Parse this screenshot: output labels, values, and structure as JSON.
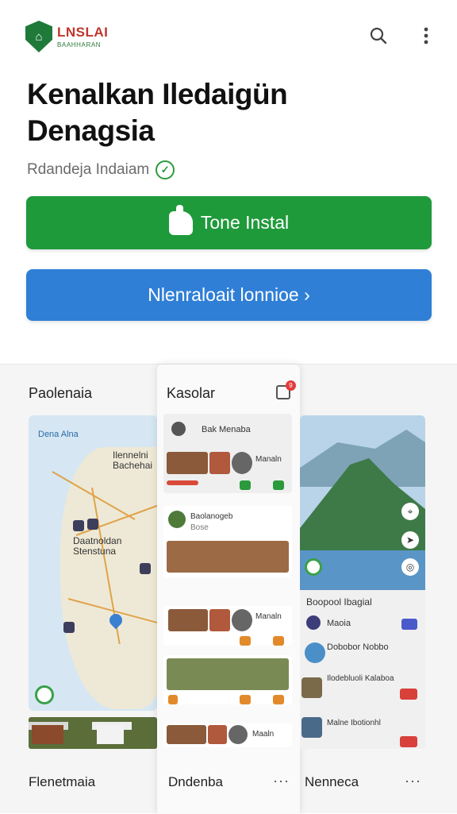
{
  "header": {
    "logo_icon": "shield-icon",
    "logo_text": "LNSLAI",
    "logo_subtext": "BAAHHARAN"
  },
  "hero": {
    "title_line1": "Kenalkan Iledaigün",
    "title_line2": "Denagsia",
    "subtitle": "Rdandeja  Indaiam"
  },
  "buttons": {
    "install_label": "Tone Instal",
    "more_label": "Nlenraloait lonnioe ›"
  },
  "colors": {
    "install_green": "#1f9a3b",
    "more_blue": "#2f7fd6"
  },
  "gallery": {
    "left": {
      "title": "Paolenaia",
      "map_label_top": "Dena   Alna",
      "map_label_mid": "Ilennelni\nBachehai",
      "map_label_city": "Daatnoldan\nStenstuna",
      "bottom_title": "Flenetmaia"
    },
    "center": {
      "title": "Kasolar",
      "badge_count": "9",
      "card_title": "Bak Menaba",
      "row1_title": "Manaln",
      "row2_title": "Baolanogeb",
      "row2_sub": "Bose",
      "row3_title": "Manaln",
      "row4_title": "Maaln",
      "bottom_title": "Dndenba"
    },
    "right": {
      "section_title": "Boopool  Ibagial",
      "row1_title": "Maoia",
      "row2_title": "Dobobor Nobbo",
      "row3_title": "Ilodebluoli Kalaboa",
      "row4_title": "Malne Ibotionhl",
      "bottom_title": "Nenneca"
    }
  }
}
